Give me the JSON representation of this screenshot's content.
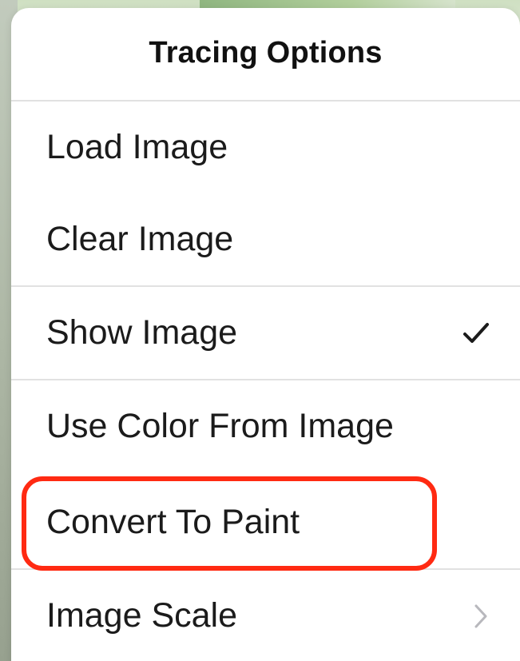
{
  "menu": {
    "title": "Tracing Options",
    "items": [
      {
        "label": "Load Image"
      },
      {
        "label": "Clear Image"
      },
      {
        "label": "Show Image",
        "checked": true
      },
      {
        "label": "Use Color From Image"
      },
      {
        "label": "Convert To Paint",
        "highlighted": true
      },
      {
        "label": "Image Scale",
        "has_submenu": true
      }
    ]
  },
  "colors": {
    "highlight": "#ff2a12",
    "menu_background": "#ffffff",
    "separator": "#e1e1e1",
    "text": "#1b1b1b",
    "chevron": "#b8b8bd"
  },
  "icons": {
    "show_image_state": "checkmark-icon",
    "image_scale_submenu": "chevron-right-icon"
  }
}
